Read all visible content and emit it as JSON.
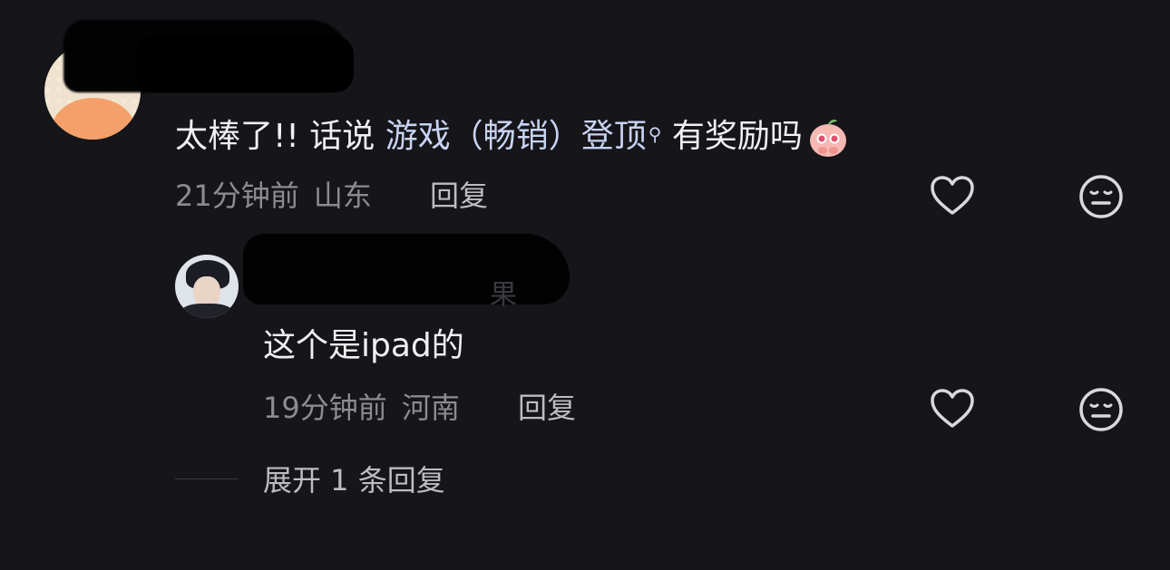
{
  "comment": {
    "text_prefix": "太棒了!! 话说 ",
    "link_text": "游戏（畅销）登顶",
    "text_suffix": " 有奖励吗",
    "emoji_name": "pleading-peach-emoji",
    "time": "21分钟前",
    "location": "山东",
    "reply_label": "回复"
  },
  "reply": {
    "ghost_char": "果",
    "text": "这个是ipad的",
    "time": "19分钟前",
    "location": "河南",
    "reply_label": "回复"
  },
  "expand_label": "展开 1 条回复",
  "icons": {
    "like": "heart-outline-icon",
    "dislike": "meh-face-icon"
  }
}
